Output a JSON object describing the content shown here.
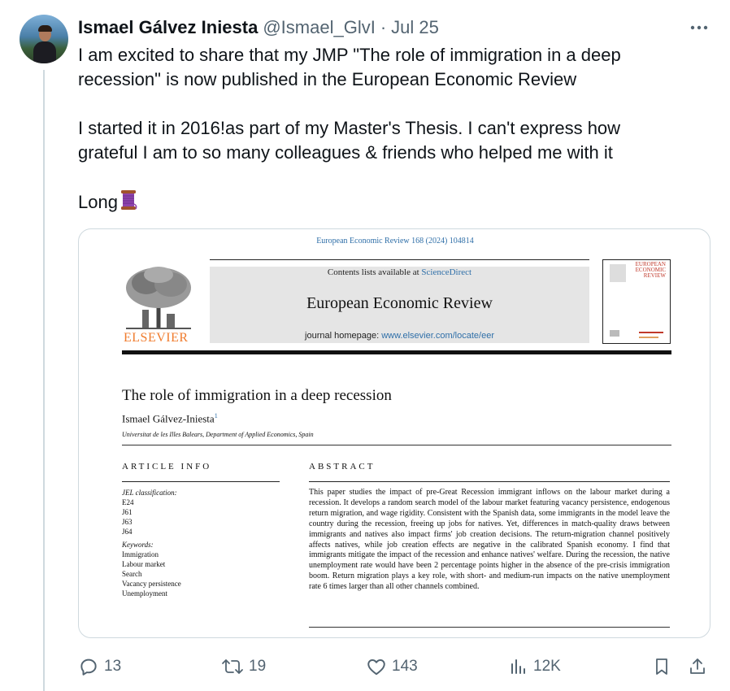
{
  "tweet": {
    "author_name": "Ismael Gálvez Iniesta",
    "handle": "@Ismael_GlvI",
    "separator": "·",
    "date": "Jul 25",
    "more_icon": "ellipsis-icon",
    "text_line1": "I am excited to share that my JMP \"The role of immigration in a deep",
    "text_line2": "recession\" is now published in the European Economic Review",
    "text_line3": "I started it in 2016!as part of my Master's Thesis. I can't express how",
    "text_line4": "grateful I am to so many colleagues  & friends who helped me with it",
    "text_line5": "Long",
    "thread_emoji": "thread-spool-icon"
  },
  "paper": {
    "citation": "European Economic Review 168 (2024) 104814",
    "contents_prefix": "Contents lists available at ",
    "contents_link": "ScienceDirect",
    "journal_name": "European Economic Review",
    "homepage_prefix": "journal homepage: ",
    "homepage_url": "www.elsevier.com/locate/eer",
    "publisher": "ELSEVIER",
    "cover_title_1": "EUROPEAN",
    "cover_title_2": "ECONOMIC",
    "cover_title_3": "REVIEW",
    "title": "The role of immigration in a deep recession",
    "author": "Ismael Gálvez-Iniesta",
    "author_sup": "1",
    "affiliation": "Universitat de les Illes Balears, Department of Applied Economics, Spain",
    "article_info_heading": "ARTICLE INFO",
    "abstract_heading": "ABSTRACT",
    "jel_label": "JEL classification:",
    "jel_codes": [
      "E24",
      "J61",
      "J63",
      "J64"
    ],
    "keywords_label": "Keywords:",
    "keywords": [
      "Immigration",
      "Labour market",
      "Search",
      "Vacancy persistence",
      "Unemployment"
    ],
    "abstract_text": "This paper studies the impact of pre-Great Recession immigrant inflows on the labour market during a recession. It develops a random search model of the labour market featuring vacancy persistence, endogenous return migration, and wage rigidity. Consistent with the Spanish data, some immigrants in the model leave the country during the recession, freeing up jobs for natives. Yet, differences in match-quality draws between immigrants and natives also impact firms' job creation decisions. The return-migration channel positively affects natives, while job creation effects are negative in the calibrated Spanish economy. I find that immigrants mitigate the impact of the recession and enhance natives' welfare. During the recession, the native unemployment rate would have been 2 percentage points higher in the absence of the pre-crisis immigration boom. Return migration plays a key role, with short- and medium-run impacts on the native unemployment rate 6 times larger than all other channels combined."
  },
  "actions": {
    "reply_count": "13",
    "retweet_count": "19",
    "like_count": "143",
    "views_count": "12K",
    "reply_icon": "reply-icon",
    "retweet_icon": "retweet-icon",
    "like_icon": "heart-icon",
    "views_icon": "views-icon",
    "bookmark_icon": "bookmark-icon",
    "share_icon": "share-icon"
  },
  "colors": {
    "text": "#0f1419",
    "secondary": "#536471",
    "border": "#cfd9de",
    "elsevier_orange": "#f07c2e",
    "link_blue": "#2f6fa8"
  }
}
